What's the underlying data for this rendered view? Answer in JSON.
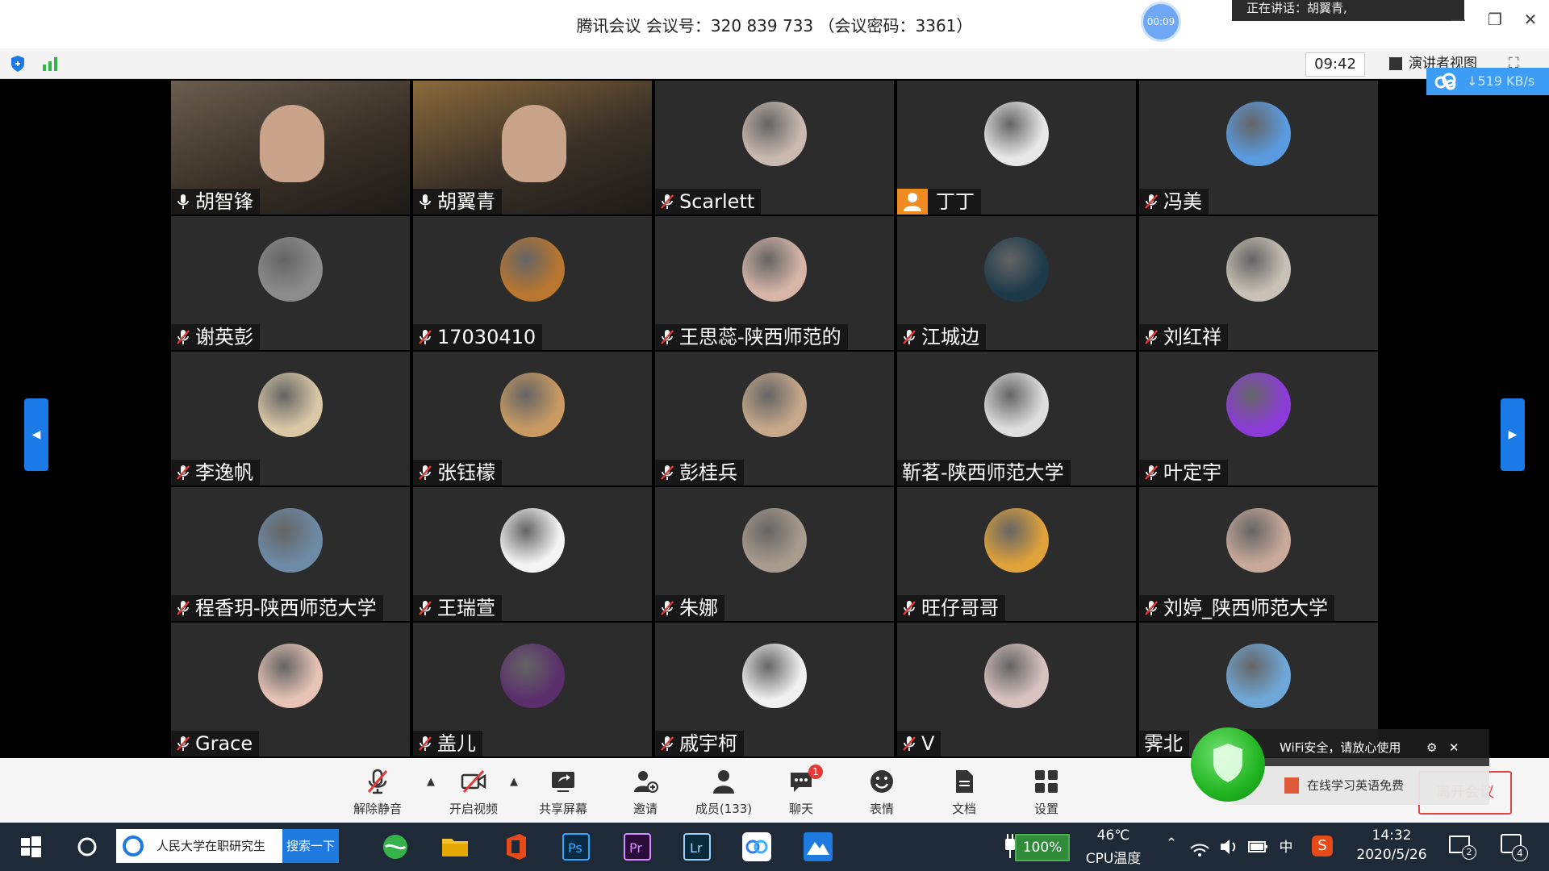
{
  "window": {
    "title": "腾讯会议 会议号：320 839 733 （会议密码：3361）",
    "timer": "00:09",
    "speaking_banner": "正在讲话：胡翼青,",
    "minimize_label": "—",
    "restore_label": "❐",
    "close_label": "✕"
  },
  "topbar": {
    "clock": "09:42",
    "presenter_view_label": "演讲者视图",
    "net_speed": "↓519 KB/s"
  },
  "participants": [
    {
      "name": "胡智锋",
      "mic": "on",
      "video": true,
      "color": "#6b5d4f"
    },
    {
      "name": "胡翼青",
      "mic": "on",
      "video": true,
      "active": true,
      "color": "#8a6a3b"
    },
    {
      "name": "Scarlett",
      "mic": "muted",
      "color": "#c9b9b0"
    },
    {
      "name": "丁丁",
      "mic": "orange",
      "color": "#e8e8e8"
    },
    {
      "name": "冯美",
      "mic": "muted",
      "color": "#5a9be0"
    },
    {
      "name": "谢英彭",
      "mic": "muted",
      "color": "#8c8c8c"
    },
    {
      "name": "17030410",
      "mic": "muted",
      "color": "#b8762f"
    },
    {
      "name": "王思蕊-陕西师范的",
      "mic": "muted",
      "color": "#d7b6a8"
    },
    {
      "name": "江城边",
      "mic": "muted",
      "color": "#1d3a4a"
    },
    {
      "name": "刘红祥",
      "mic": "muted",
      "color": "#c9c1b5"
    },
    {
      "name": "李逸帆",
      "mic": "muted",
      "color": "#d9c7a6"
    },
    {
      "name": "张钰檬",
      "mic": "muted",
      "color": "#c99a62"
    },
    {
      "name": "彭桂兵",
      "mic": "muted",
      "color": "#c7a88a"
    },
    {
      "name": "靳茗-陕西师范大学",
      "mic": "none",
      "color": "#dedede"
    },
    {
      "name": "叶定宇",
      "mic": "muted",
      "color": "#8b3bd8"
    },
    {
      "name": "程香玥-陕西师范大学",
      "mic": "muted",
      "color": "#6d8aa6"
    },
    {
      "name": "王瑞萱",
      "mic": "muted",
      "color": "#f4f4f4"
    },
    {
      "name": "朱娜",
      "mic": "muted",
      "color": "#a99b8e"
    },
    {
      "name": "旺仔哥哥",
      "mic": "muted",
      "color": "#e0a23a"
    },
    {
      "name": "刘婷_陕西师范大学",
      "mic": "muted",
      "color": "#c9a99a"
    },
    {
      "name": "Grace",
      "mic": "muted",
      "color": "#e7c3b6"
    },
    {
      "name": "盖儿",
      "mic": "muted",
      "color": "#5a2f6b"
    },
    {
      "name": "戚宇柯",
      "mic": "muted",
      "color": "#f1f1f1"
    },
    {
      "name": "V",
      "mic": "muted",
      "color": "#d8c2c0"
    },
    {
      "name": "霁北",
      "mic": "none",
      "color": "#6fa8d8"
    }
  ],
  "toolbar": {
    "unmute": "解除静音",
    "start_video": "开启视频",
    "share_screen": "共享屏幕",
    "invite": "邀请",
    "members": "成员(133)",
    "chat": "聊天",
    "chat_badge": "1",
    "reactions": "表情",
    "documents": "文档",
    "settings": "设置",
    "leave": "离开会议"
  },
  "popup": {
    "wifi_text": "WiFi安全，请放心使用",
    "ad_text": "在线学习英语免费"
  },
  "taskbar": {
    "search_text": "人民大学在职研究生",
    "search_button": "搜索一下",
    "battery": "100%",
    "cpu_temp": "46℃",
    "cpu_label": "CPU温度",
    "ime": "中",
    "time": "14:32",
    "date": "2020/5/26",
    "notif_count": "4",
    "desktop_count": "2"
  },
  "colors": {
    "accent": "#1a7ae8",
    "active_border": "#2fd36a",
    "leave": "#e04848"
  }
}
